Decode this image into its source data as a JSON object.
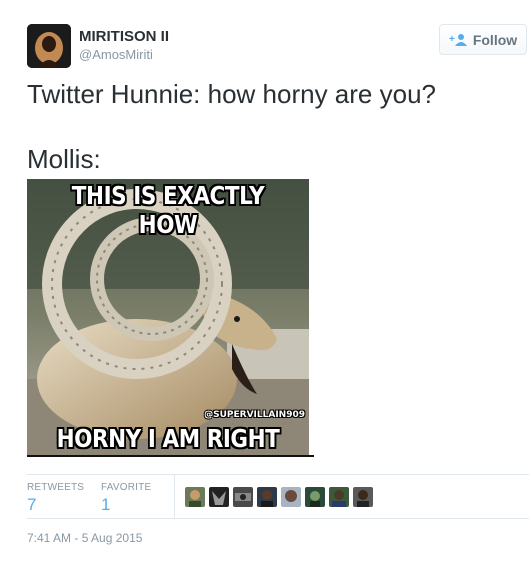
{
  "user": {
    "name": "MIRITISON II",
    "handle": "@AmosMiriti",
    "avatar_icon": "person-silhouette-avatar"
  },
  "follow_button": {
    "label": "Follow",
    "icon": "add-user-icon"
  },
  "tweet": {
    "line1": "Twitter Hunnie: how horny are you?",
    "line2": "Mollis:"
  },
  "meme": {
    "top_text": "THIS IS EXACTLY HOW",
    "bottom_text": "HORNY I AM RIGHT NOW",
    "watermark": "@SUPERVILLAIN909"
  },
  "stats": {
    "retweets_label": "RETWEETS",
    "retweets_value": "7",
    "favorites_label": "FAVORITE",
    "favorites_value": "1"
  },
  "favoriters": [
    "face-1",
    "face-2",
    "face-3",
    "face-4",
    "face-5",
    "face-6",
    "face-7",
    "face-8"
  ],
  "timestamp": "7:41 AM - 5 Aug 2015",
  "colors": {
    "link": "#55acee",
    "muted": "#8899a6",
    "text": "#292f33",
    "border": "#e1e8ed"
  }
}
